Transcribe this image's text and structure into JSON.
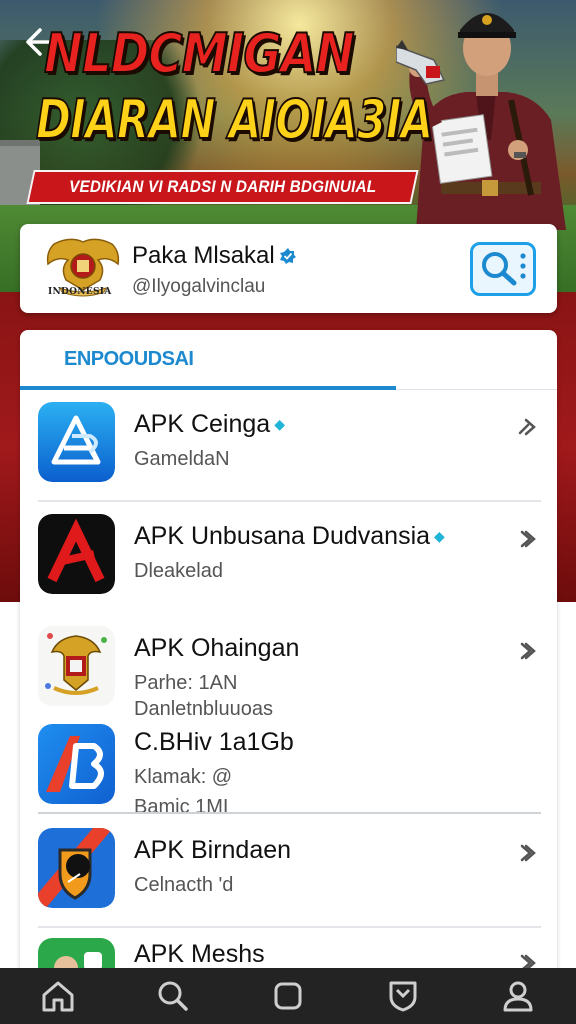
{
  "banner": {
    "headline_line1": "NLDCMIGAN",
    "headline_line2": "DIARAN AIOIA3IA",
    "subheadline": "VEDIKIAN VI RADSI N DARIH BDGINUIAL"
  },
  "profile": {
    "emblem_caption": "INDONESIA",
    "name": "Paka Mlsakal",
    "handle": "@Ilyogalvinclau"
  },
  "section": {
    "tab_label": "ENPOOUDSAI"
  },
  "apps": [
    {
      "title": "APK Ceinga",
      "subtitle": "GameldaN",
      "subtitle2": "",
      "verified": true,
      "icon": "stylized-a-blue-icon"
    },
    {
      "title": "APK Unbusana Dudvansia",
      "subtitle": "Dleakelad",
      "subtitle2": "",
      "verified": true,
      "icon": "red-a-logo-icon"
    },
    {
      "title": "APK Ohaingan",
      "subtitle": "Parhe: 1AN",
      "subtitle2": "Danletnbluuoas",
      "verified": false,
      "icon": "garuda-crest-icon"
    },
    {
      "title": "C.BHiv 1a1Gb",
      "subtitle": "Klamak: @",
      "subtitle2": "Bamic 1MI",
      "verified": false,
      "icon": "red-blue-b-logo-icon"
    },
    {
      "title": "APK Birndaen",
      "subtitle": "Celnacth 'd",
      "subtitle2": "",
      "verified": false,
      "icon": "shield-badge-icon"
    },
    {
      "title": "APK Meshs",
      "subtitle": "",
      "subtitle2": "",
      "verified": false,
      "icon": "green-portrait-icon"
    }
  ],
  "nav": [
    {
      "name": "home-icon"
    },
    {
      "name": "search-icon"
    },
    {
      "name": "square-icon"
    },
    {
      "name": "shield-icon"
    },
    {
      "name": "profile-icon"
    }
  ],
  "colors": {
    "accent_blue": "#1d8ad0",
    "banner_red": "#c8161b",
    "banner_yellow": "#ffd21a",
    "nav_bg": "#232323"
  }
}
